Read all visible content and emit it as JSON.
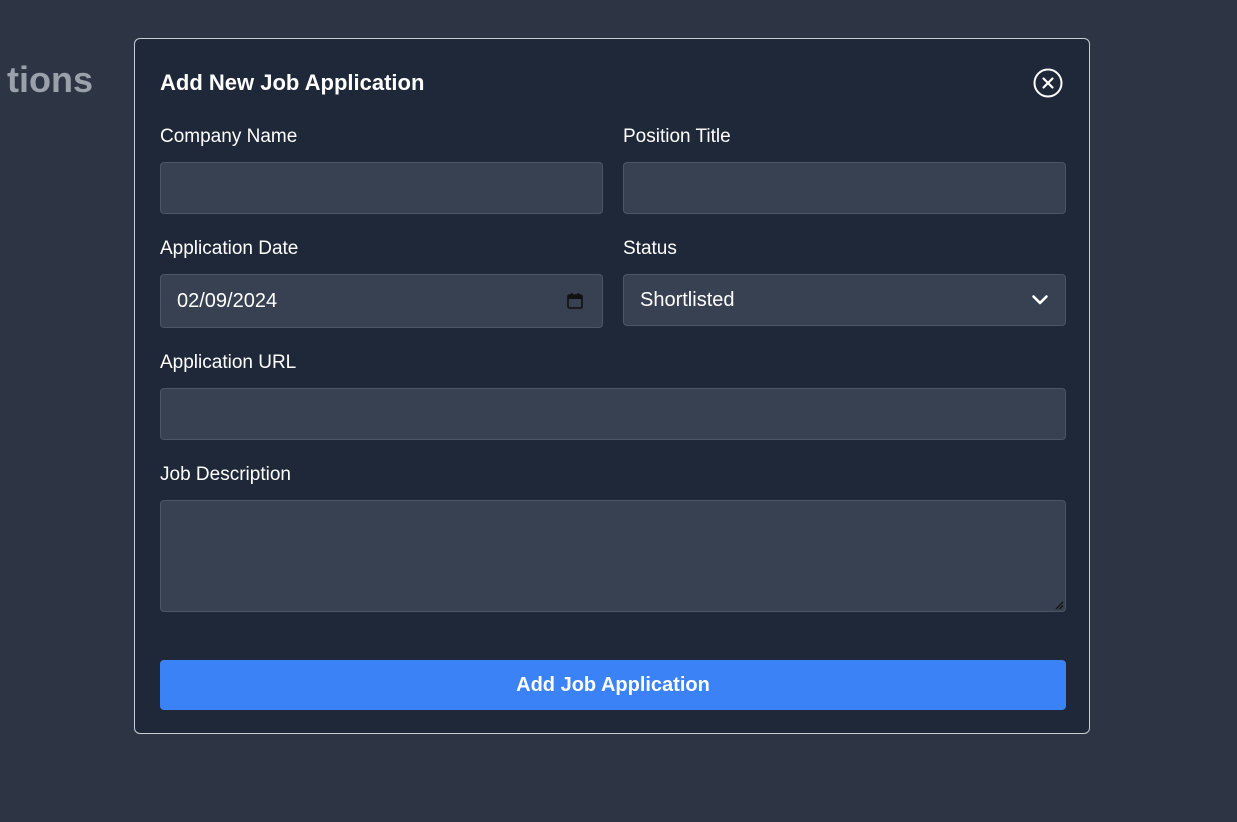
{
  "background": {
    "heading_fragment": "tions"
  },
  "modal": {
    "title": "Add New Job Application",
    "close_icon": "close-circle-icon",
    "fields": {
      "company_name": {
        "label": "Company Name",
        "value": ""
      },
      "position_title": {
        "label": "Position Title",
        "value": ""
      },
      "application_date": {
        "label": "Application Date",
        "value": "02/09/2024"
      },
      "status": {
        "label": "Status",
        "selected": "Shortlisted"
      },
      "application_url": {
        "label": "Application URL",
        "value": ""
      },
      "job_description": {
        "label": "Job Description",
        "value": ""
      }
    },
    "submit_label": "Add Job Application"
  },
  "colors": {
    "page_bg": "#2d3544",
    "modal_bg": "#1f2838",
    "input_bg": "#374151",
    "accent": "#3b82f6"
  }
}
